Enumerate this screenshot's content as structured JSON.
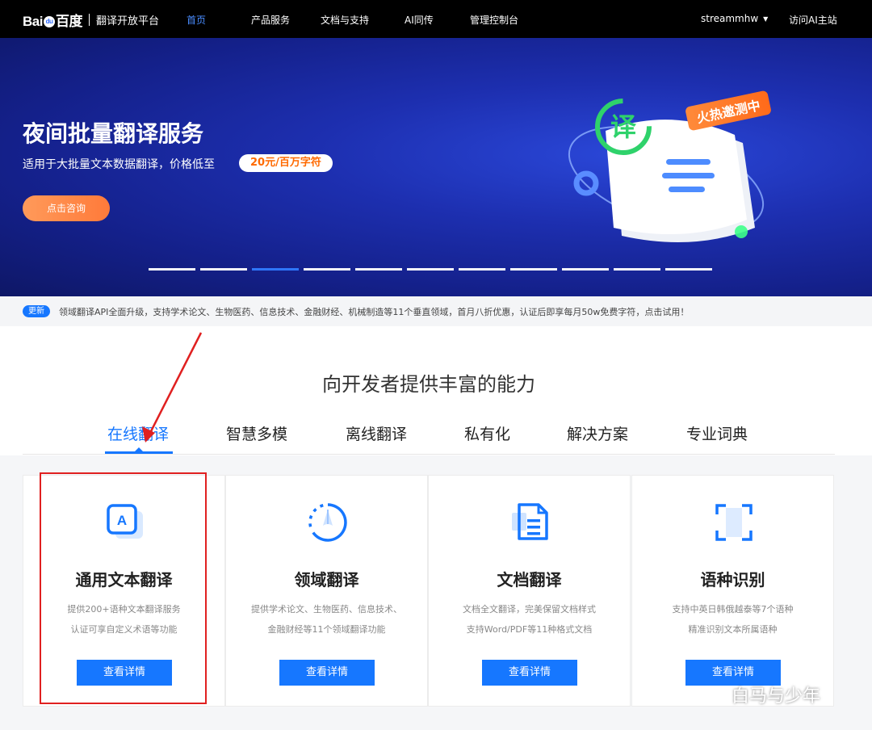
{
  "nav": {
    "logo": {
      "brand": "Bai",
      "brand_suffix": "百度",
      "platform": "翻译开放平台"
    },
    "items": [
      {
        "label": "首页",
        "active": true
      },
      {
        "label": "产品服务"
      },
      {
        "label": "文档与支持"
      },
      {
        "label": "AI同传"
      },
      {
        "label": "管理控制台"
      }
    ],
    "user": "streammhw",
    "visit_label": "访问AI主站"
  },
  "banner": {
    "title": "夜间批量翻译服务",
    "subtitle": "适用于大批量文本数据翻译，价格低至",
    "price": "20元/百万字符",
    "cta": "点击咨询",
    "badge": "火热邀测中",
    "illus_char": "译",
    "slide_count": 11,
    "active_slide": 2
  },
  "notice": {
    "badge": "更新",
    "text": "领域翻译API全面升级，支持学术论文、生物医药、信息技术、金融财经、机械制造等11个垂直领域，首月八折优惠，认证后即享每月50w免费字符，点击试用！"
  },
  "section": {
    "title": "向开发者提供丰富的能力",
    "tabs": [
      {
        "label": "在线翻译",
        "active": true
      },
      {
        "label": "智慧多模"
      },
      {
        "label": "离线翻译"
      },
      {
        "label": "私有化"
      },
      {
        "label": "解决方案"
      },
      {
        "label": "专业词典"
      }
    ],
    "cards": [
      {
        "icon": "text-translate-icon",
        "icon_char": "A",
        "title": "通用文本翻译",
        "desc1": "提供200+语种文本翻译服务",
        "desc2": "认证可享自定义术语等功能",
        "button": "查看详情"
      },
      {
        "icon": "domain-compass-icon",
        "title": "领域翻译",
        "desc1": "提供学术论文、生物医药、信息技术、",
        "desc2": "金融财经等11个领域翻译功能",
        "button": "查看详情"
      },
      {
        "icon": "document-icon",
        "title": "文档翻译",
        "desc1": "文档全文翻译，完美保留文档样式",
        "desc2": "支持Word/PDF等11种格式文档",
        "button": "查看详情"
      },
      {
        "icon": "scan-frame-icon",
        "title": "语种识别",
        "desc1": "支持中英日韩俄越泰等7个语种",
        "desc2": "精准识别文本所属语种",
        "button": "查看详情"
      }
    ]
  },
  "watermark": "白马与少年",
  "colors": {
    "accent": "#1677ff",
    "nav_bg": "#000000",
    "cta_orange": "#ff7a3a",
    "highlight_red": "#e02020"
  }
}
